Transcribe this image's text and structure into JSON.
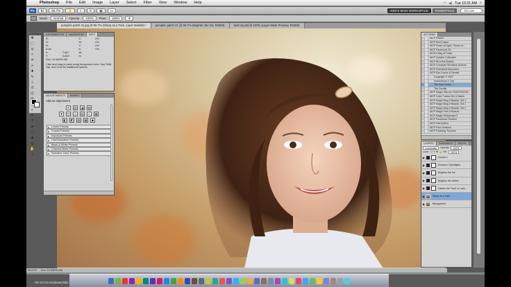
{
  "menubar": {
    "app": "Photoshop",
    "items": [
      "File",
      "Edit",
      "Image",
      "Layer",
      "Select",
      "Filter",
      "View",
      "Window",
      "Help"
    ],
    "clock": "Tue 10:31 AM"
  },
  "optbar": {
    "logo": "Ps",
    "zoom": "66.7%",
    "workspace": "JODI'S MAIN WORKSPACE",
    "essentials": "ESSENTIALS",
    "search_placeholder": "CS Live"
  },
  "optbar2": {
    "mode_label": "Mode:",
    "mode_value": "Normal",
    "opacity_label": "Opacity:",
    "opacity_value": "100%",
    "flow_label": "Flow:",
    "flow_value": "100%"
  },
  "doctabs": [
    {
      "label": "pumpkin patch-41.jpg @ 66.7% (Sharp as a Tack, Layer Mask/8) *"
    },
    {
      "label": "pumpkin patch-41 @ 66.7% (Brighten the Iris, RGB/8)"
    },
    {
      "label": "tack tut.psd @ 100% (Layer Mask Preview, RGB/8)"
    }
  ],
  "infopanel": {
    "tabs": [
      "INFORMATION",
      "NAVIGATOR",
      "INFO"
    ],
    "rows": [
      [
        "R:",
        "",
        "C:",
        "0%"
      ],
      [
        "G:",
        "",
        "M:",
        "0%"
      ],
      [
        "B:",
        "",
        "Y:",
        "0%"
      ],
      [
        "8-bit",
        "",
        "K:",
        "0%"
      ],
      [
        "X:",
        "7.667",
        "W:",
        ""
      ],
      [
        "Y:",
        "4.653",
        "H:",
        ""
      ]
    ],
    "doc": "Doc: 10.9M/90.5M",
    "note": "Click and drag to paint using foreground color. Use Shift, Opt, and Cmd for additional options."
  },
  "adjpanel": {
    "tabs": [
      "ADJUSTMENTS",
      "MASKS"
    ],
    "title": "Add an adjustment",
    "icons_row1": [
      "☀",
      "▥",
      "◪",
      "▨"
    ],
    "icons_row2": [
      "▼",
      "◫",
      "◬",
      "▤",
      "◐",
      "▦"
    ],
    "icons_row3": [
      "◧",
      "◩",
      "▧",
      "▩",
      "◆"
    ],
    "presets": [
      "Levels Presets",
      "Curves Presets",
      "Exposure Presets",
      "Hue/Saturation Presets",
      "Black & White Presets",
      "Channel Mixer Presets",
      "Selective Color Presets"
    ]
  },
  "actpanel": {
    "tabs": [
      "ACTIONS"
    ],
    "items": [
      {
        "label": "MCP Fusion",
        "sub": false,
        "sel": false
      },
      {
        "label": "MCP Mini Fusion",
        "sub": false,
        "sel": false
      },
      {
        "label": "MCP Touch of Light / Touch of...",
        "sub": false,
        "sel": false
      },
      {
        "label": "MCP Facebook Fix",
        "sub": false,
        "sel": false
      },
      {
        "label": "MCP's Bag of Tricks",
        "sub": false,
        "sel": false
      },
      {
        "label": "MCP Quickie Collection",
        "sub": false,
        "sel": false
      },
      {
        "label": "MCP All in the Details",
        "sub": false,
        "sel": false
      },
      {
        "label": "MCP Complete Workflow Actions",
        "sub": false,
        "sel": false
      },
      {
        "label": "MCP Cherished Memories",
        "sub": false,
        "sel": false
      },
      {
        "label": "MCP Eye Doctor & Dentist",
        "sub": false,
        "sel": false
      },
      {
        "label": "Copyright © 2007",
        "sub": true,
        "sel": false
      },
      {
        "label": "Instructions & Tips",
        "sub": true,
        "sel": false
      },
      {
        "label": "The Eye Doctor",
        "sub": true,
        "sel": true
      },
      {
        "label": "The Dentist",
        "sub": true,
        "sel": false
      },
      {
        "label": "MCP Magic Skin for CS2/CS3/CS4",
        "sub": false,
        "sel": false
      },
      {
        "label": "MCP Color Fusion Mix & Match",
        "sub": false,
        "sel": false
      },
      {
        "label": "MCP Magic Blog It Boards: Set 1",
        "sub": false,
        "sel": false
      },
      {
        "label": "MCP Magic Blog It Boards: Set 2",
        "sub": false,
        "sel": false
      },
      {
        "label": "MCP Magic Blog It Boards: Set 3",
        "sub": false,
        "sel": false
      },
      {
        "label": "MCP Magic Print It Boards",
        "sub": false,
        "sel": false
      },
      {
        "label": "MCP Magic Storyboard 3",
        "sub": false,
        "sel": false
      },
      {
        "label": "MCP Facebook Timeline",
        "sub": false,
        "sel": false
      },
      {
        "label": "MCP Fall Actions",
        "sub": false,
        "sel": false
      },
      {
        "label": "MCP Four Seasons",
        "sub": false,
        "sel": false
      },
      {
        "label": "MCP Finishing Touches",
        "sub": false,
        "sel": false
      }
    ]
  },
  "laypanel": {
    "tabs": [
      "LAYERS",
      "CHANNELS",
      "PATHS"
    ],
    "blend": "Luminosity",
    "opacity_label": "Opacity:",
    "opacity": "100%",
    "lock_label": "Lock:",
    "fill_label": "Fill:",
    "fill": "100%",
    "layers": [
      {
        "name": "Curves 1",
        "thumb": "m",
        "sel": false
      },
      {
        "name": "Enhance Catchlights",
        "thumb": "d",
        "sel": false
      },
      {
        "name": "Brighten the Iris",
        "thumb": "d",
        "sel": false
      },
      {
        "name": "Brighten the whites",
        "thumb": "d",
        "sel": false
      },
      {
        "name": "Darken the Pupil or Lash...",
        "thumb": "d",
        "sel": false
      },
      {
        "name": "Sharp as a Tack",
        "thumb": "photo",
        "sel": true
      },
      {
        "name": "Background",
        "thumb": "photo",
        "sel": false
      }
    ]
  },
  "status": {
    "zoom": "66.67%",
    "doc": "Doc: 10.9M/90.5M"
  },
  "video": {
    "caption": "HD 0:0:10 Keyboard Blur"
  },
  "colors": {
    "accent": "#4f86c6",
    "selected_row": "#7fa8d8"
  }
}
